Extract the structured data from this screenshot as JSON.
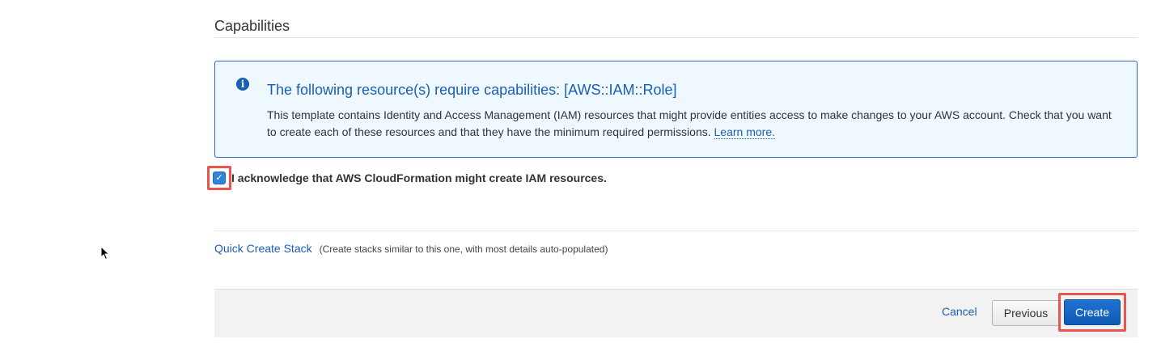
{
  "section": {
    "title": "Capabilities"
  },
  "info_box": {
    "icon": "info-icon",
    "icon_glyph": "i",
    "title": "The following resource(s) require capabilities: [AWS::IAM::Role]",
    "body": "This template contains Identity and Access Management (IAM) resources that might provide entities access to make changes to your AWS account. Check that you want to create each of these resources and that they have the minimum required permissions.",
    "link_text": "Learn more."
  },
  "acknowledge": {
    "checked": true,
    "check_glyph": "✓",
    "label": "I acknowledge that AWS CloudFormation might create IAM resources."
  },
  "quick_create": {
    "link_text": "Quick Create Stack",
    "note": "(Create stacks similar to this one, with most details auto-populated)"
  },
  "footer": {
    "cancel_label": "Cancel",
    "previous_label": "Previous",
    "create_label": "Create"
  },
  "colors": {
    "link": "#1a5fb4",
    "info_background": "#f0f8ff",
    "info_border": "#2e6bc6",
    "highlight": "#e8554e",
    "primary_button": "#1f72d1"
  }
}
